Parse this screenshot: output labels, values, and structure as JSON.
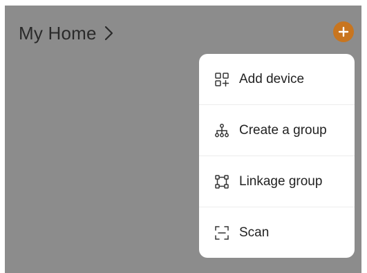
{
  "header": {
    "title": "My Home"
  },
  "menu": {
    "items": [
      {
        "label": "Add device",
        "icon": "add-device-icon"
      },
      {
        "label": "Create a group",
        "icon": "hierarchy-icon"
      },
      {
        "label": "Linkage group",
        "icon": "linkage-icon"
      },
      {
        "label": "Scan",
        "icon": "scan-icon"
      }
    ]
  },
  "colors": {
    "accent": "#c8751f",
    "overlay": "#8c8c8c",
    "menu_bg": "#ffffff",
    "text": "#222222"
  }
}
